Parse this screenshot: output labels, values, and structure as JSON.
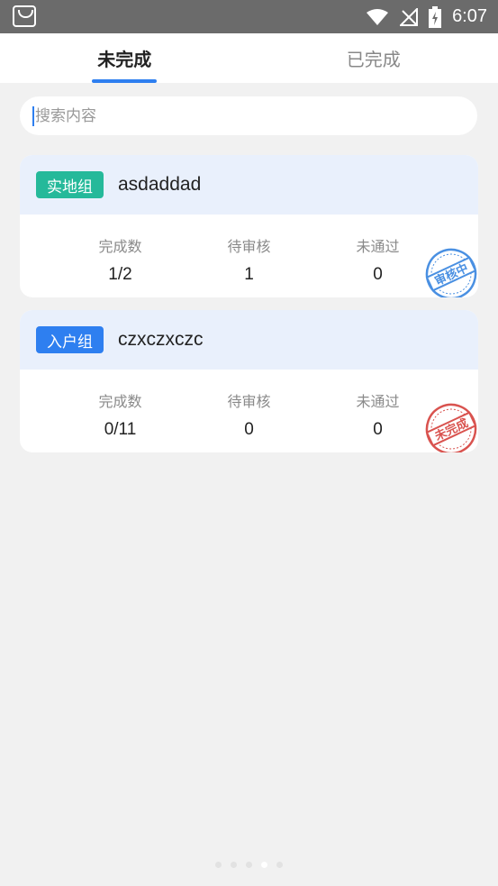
{
  "status_bar": {
    "time": "6:07"
  },
  "tabs": [
    {
      "label": "未完成",
      "active": true
    },
    {
      "label": "已完成",
      "active": false
    }
  ],
  "search": {
    "placeholder": "搜索内容",
    "value": ""
  },
  "cards": [
    {
      "tag": "实地组",
      "tag_color": "#25b99a",
      "name": "asdaddad",
      "stats": [
        {
          "label": "完成数",
          "value": "1/2"
        },
        {
          "label": "待审核",
          "value": "1"
        },
        {
          "label": "未通过",
          "value": "0"
        }
      ],
      "stamp": {
        "text": "审核中",
        "color": "#4a90e2"
      }
    },
    {
      "tag": "入户组",
      "tag_color": "#2e7ff0",
      "name": "czxczxczc",
      "stats": [
        {
          "label": "完成数",
          "value": "0/11"
        },
        {
          "label": "待审核",
          "value": "0"
        },
        {
          "label": "未通过",
          "value": "0"
        }
      ],
      "stamp": {
        "text": "未完成",
        "color": "#d9534f"
      }
    }
  ],
  "pager": {
    "count": 5,
    "active_index": 3
  }
}
